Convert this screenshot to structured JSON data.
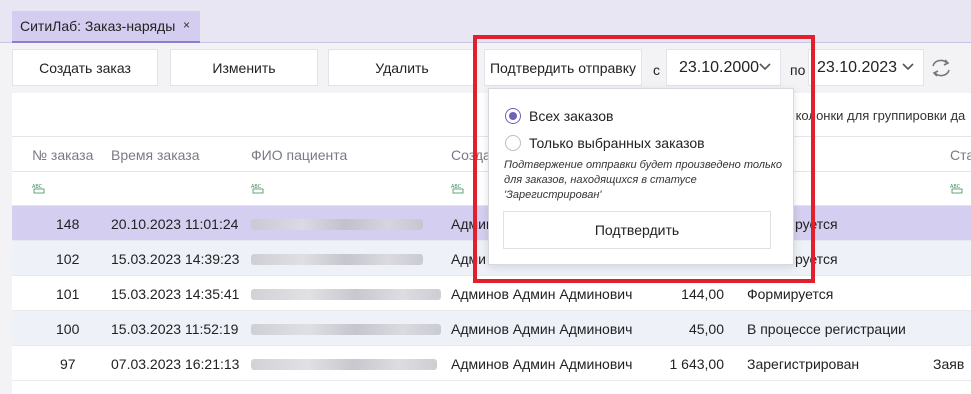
{
  "tab": {
    "title": "СитиЛаб: Заказ-наряды",
    "close": "×"
  },
  "toolbar": {
    "create": "Создать заказ",
    "edit": "Изменить",
    "delete": "Удалить",
    "confirm_send": "Подтвердить отправку",
    "from_label": "с",
    "from_date": "23.10.2000",
    "to_label": "по",
    "to_date": "23.10.2023"
  },
  "grid": {
    "group_hint": "т колонки для группировки да",
    "columns": [
      "№ заказа",
      "Время заказа",
      "ФИО пациента",
      "Созда",
      "Ста"
    ],
    "rows": [
      {
        "num": "148",
        "time": "20.10.2023 11:01:24",
        "creator": "Админ",
        "sum": "",
        "status": "руется",
        "extra": "",
        "selected": true
      },
      {
        "num": "102",
        "time": "15.03.2023 14:39:23",
        "creator": "Адми",
        "sum": "",
        "status": "руется",
        "extra": ""
      },
      {
        "num": "101",
        "time": "15.03.2023 14:35:41",
        "creator": "Админов Админ Админович",
        "sum": "144,00",
        "status": "Формируется",
        "extra": ""
      },
      {
        "num": "100",
        "time": "15.03.2023 11:52:19",
        "creator": "Админов Админ Админович",
        "sum": "45,00",
        "status": "В процессе регистрации",
        "extra": ""
      },
      {
        "num": "97",
        "time": "07.03.2023 16:21:13",
        "creator": "Админов Админ Админович",
        "sum": "1 643,00",
        "status": "Зарегистрирован",
        "extra": "Заяв"
      }
    ]
  },
  "popup": {
    "option_all": "Всех заказов",
    "option_selected": "Только выбранных заказов",
    "selected_option": "all",
    "note": "Подтвержение отправки будет произведено только для заказов, находящихся в статусе 'Зарегистрирован'",
    "confirm": "Подтвердить"
  },
  "colors": {
    "accent": "#6c62b8",
    "selected_row": "#d4cff0",
    "highlight": "#e0202c"
  }
}
